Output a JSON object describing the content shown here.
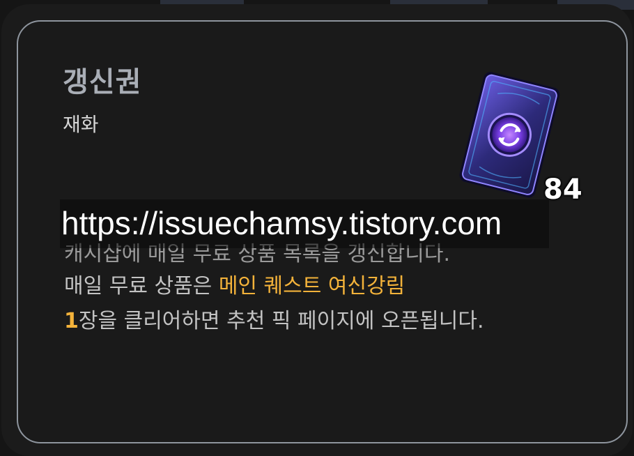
{
  "item": {
    "name": "갱신권",
    "category": "재화",
    "count": "84",
    "icon": "refresh-card-icon"
  },
  "watermark": {
    "text": "https://issuechamsy.tistory.com"
  },
  "description": {
    "line1": "캐시샵에 매일 무료 상품 목록을 갱신합니다.",
    "line2_prefix": "매일 무료 상품은 ",
    "line2_highlight": "메인 퀘스트 여신강림",
    "line3_highlight": "1",
    "line3_suffix": "장을 클리어하면 추천 픽 페이지에 오픈됩니다."
  },
  "colors": {
    "highlight": "#f3b23a",
    "frame_border": "#8e959e",
    "title": "#a9aeb6"
  }
}
